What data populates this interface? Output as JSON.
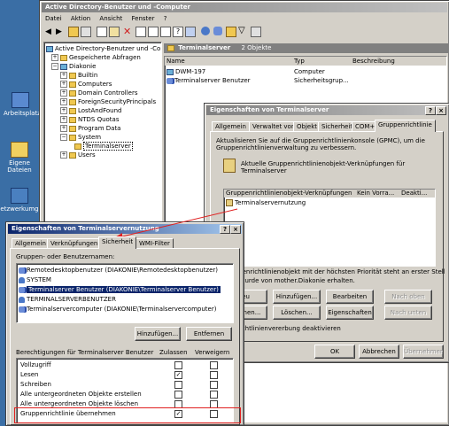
{
  "desktop": {
    "icons": [
      {
        "label": "Arbeitsplatz",
        "icon": "computer-icon"
      },
      {
        "label": "Eigene Dateien",
        "icon": "documents-icon"
      },
      {
        "label": "etzwerkumg",
        "icon": "network-icon"
      }
    ]
  },
  "mmc": {
    "title": "Active Directory-Benutzer und -Computer",
    "menu": [
      "Datei",
      "Aktion",
      "Ansicht",
      "Fenster",
      "?"
    ],
    "tree": [
      {
        "label": "Active Directory-Benutzer und -Computer",
        "level": 0
      },
      {
        "label": "Gespeicherte Abfragen",
        "level": 1
      },
      {
        "label": "Diakonie",
        "level": 1
      },
      {
        "label": "Builtin",
        "level": 2
      },
      {
        "label": "Computers",
        "level": 2
      },
      {
        "label": "Domain Controllers",
        "level": 2
      },
      {
        "label": "ForeignSecurityPrincipals",
        "level": 2
      },
      {
        "label": "LostAndFound",
        "level": 2
      },
      {
        "label": "NTDS Quotas",
        "level": 2
      },
      {
        "label": "Program Data",
        "level": 2
      },
      {
        "label": "System",
        "level": 2
      },
      {
        "label": "Terminalserver",
        "level": 3
      },
      {
        "label": "Users",
        "level": 2
      }
    ],
    "right_header": {
      "title": "Terminalserver",
      "count": "2 Objekte"
    },
    "columns": [
      "Name",
      "Typ",
      "Beschreibung"
    ],
    "rows": [
      {
        "name": "DWM-197",
        "type": "Computer",
        "desc": ""
      },
      {
        "name": "Terminalserver Benutzer",
        "type": "Sicherheitsgrup...",
        "desc": ""
      }
    ]
  },
  "ou_dialog": {
    "title": "Eigenschaften von Terminalserver",
    "tabs": [
      "Allgemein",
      "Verwaltet von",
      "Objekt",
      "Sicherheit",
      "COM+",
      "Gruppenrichtlinie"
    ],
    "info": "Aktualisieren Sie auf die Gruppenrichtlinienkonsole (GPMC), um die Gruppenrichtlinienverwaltung zu verbessern.",
    "link_label": "Aktuelle Gruppenrichtlinienobjekt-Verknüpfungen für Terminalserver",
    "list_columns": [
      "Gruppenrichtlinienobjekt-Verknüpfungen",
      "Kein Vorra...",
      "Deakti..."
    ],
    "list_items": [
      "Terminalservernutzung"
    ],
    "note1": "Gruppenrichtlinienobjekt mit der höchsten Priorität steht an erster Stelle.",
    "note2": "Liste wurde von mother.Diakonie erhalten.",
    "buttons_row1": [
      "Neu",
      "Hinzufügen...",
      "Bearbeiten",
      "Nach oben"
    ],
    "buttons_row2": [
      "Optionen...",
      "Löschen...",
      "Eigenschaften",
      "Nach unten"
    ],
    "checkbox_label": "Richtlinienvererbung deaktivieren",
    "footer": [
      "OK",
      "Abbrechen",
      "Übernehmen"
    ]
  },
  "gpo_dialog": {
    "title": "Eigenschaften von Terminalservernutzung",
    "tabs": [
      "Allgemein",
      "Verknüpfungen",
      "Sicherheit",
      "WMI-Filter"
    ],
    "groups_label": "Gruppen- oder Benutzernamen:",
    "groups": [
      {
        "name": "Remotedesktopbenutzer (DIAKONIE\\Remotedesktopbenutzer)",
        "icon": "group-icon"
      },
      {
        "name": "SYSTEM",
        "icon": "user-icon"
      },
      {
        "name": "Terminalserver Benutzer (DIAKONIE\\Terminalserver Benutzer)",
        "icon": "group-icon",
        "selected": true
      },
      {
        "name": "TERMINALSERVERBENUTZER",
        "icon": "user-icon"
      },
      {
        "name": "Terminalservercomputer (DIAKONIE\\Terminalservercomputer)",
        "icon": "group-icon"
      }
    ],
    "add_button": "Hinzufügen...",
    "remove_button": "Entfernen",
    "perm_label": "Berechtigungen für Terminalserver Benutzer",
    "perm_cols": [
      "Zulassen",
      "Verweigern"
    ],
    "permissions": [
      {
        "name": "Vollzugriff",
        "allow": false,
        "deny": false
      },
      {
        "name": "Lesen",
        "allow": true,
        "deny": false
      },
      {
        "name": "Schreiben",
        "allow": false,
        "deny": false
      },
      {
        "name": "Alle untergeordneten Objekte erstellen",
        "allow": false,
        "deny": false
      },
      {
        "name": "Alle untergeordneten Objekte löschen",
        "allow": false,
        "deny": false
      },
      {
        "name": "Gruppenrichtlinie übernehmen",
        "allow": true,
        "deny": false
      }
    ]
  },
  "colors": {
    "accent": "#0a246a",
    "highlight": "#e02020",
    "desktop": "#3a6ea5",
    "selection": "#0a246a"
  }
}
